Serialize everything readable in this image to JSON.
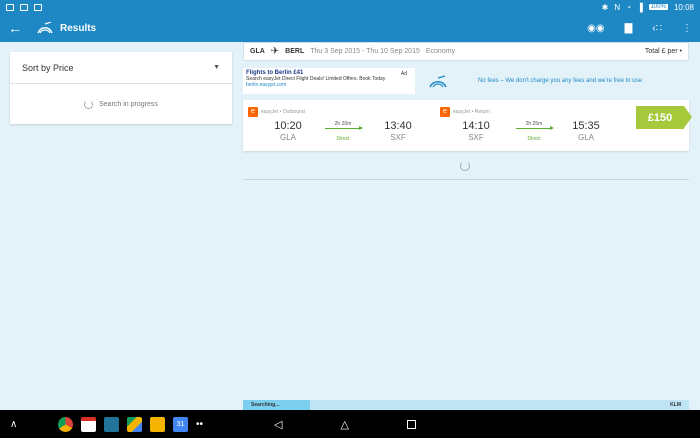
{
  "statusbar": {
    "time": "10:08",
    "battery": "100%",
    "icons": [
      "notification-icon",
      "image-icon",
      "image-icon",
      "bluetooth-icon",
      "nfc-icon",
      "wifi-icon",
      "signal-icon",
      "battery-icon"
    ]
  },
  "toolbar": {
    "title": "Results",
    "back_icon": "arrow-left-icon",
    "actions": [
      "binoculars-icon",
      "chart-icon",
      "share-icon",
      "more-vert-icon"
    ]
  },
  "sort": {
    "label": "Sort by Price",
    "progress": "Search in progress"
  },
  "search": {
    "from": "GLA",
    "to": "BERL",
    "dates": "Thu 3 Sep 2015 - Thu 10 Sep 2015",
    "cabin": "Economy",
    "right": "Total £ per •"
  },
  "ad": {
    "title": "Flights to Berlin £41",
    "body": "Search easyJet Direct Flight Deals! Limited Offers. Book Today",
    "link": "berlin.easyjet.com",
    "badge": "Ad"
  },
  "nofees": {
    "text": "No fees – We don't charge you any fees and we're free to use"
  },
  "result": {
    "price": "£150",
    "outbound": {
      "carrier": "easyJet • Outbound",
      "depart_time": "10:20",
      "depart_code": "GLA",
      "duration": "2h 20m",
      "stops": "Direct",
      "arrive_time": "13:40",
      "arrive_code": "SXF"
    },
    "return": {
      "carrier": "easyJet • Return",
      "depart_time": "14:10",
      "depart_code": "SXF",
      "duration": "2h 25m",
      "stops": "Direct",
      "arrive_time": "15:35",
      "arrive_code": "GLA"
    }
  },
  "progress": {
    "label": "Searching...",
    "airline": "KLM",
    "fraction": 0.15
  },
  "navbar": {
    "apps": [
      "chrome-icon",
      "gmail-icon",
      "wordpress-icon",
      "drive-icon",
      "pc-icon",
      "calendar-icon"
    ],
    "calendar_day": "31",
    "keys": [
      "back-icon",
      "home-icon",
      "recents-icon"
    ]
  },
  "colors": {
    "brand": "#1e88c5",
    "price": "#a5c93a",
    "direct": "#5cab2e",
    "easyjet": "#ff6600"
  }
}
